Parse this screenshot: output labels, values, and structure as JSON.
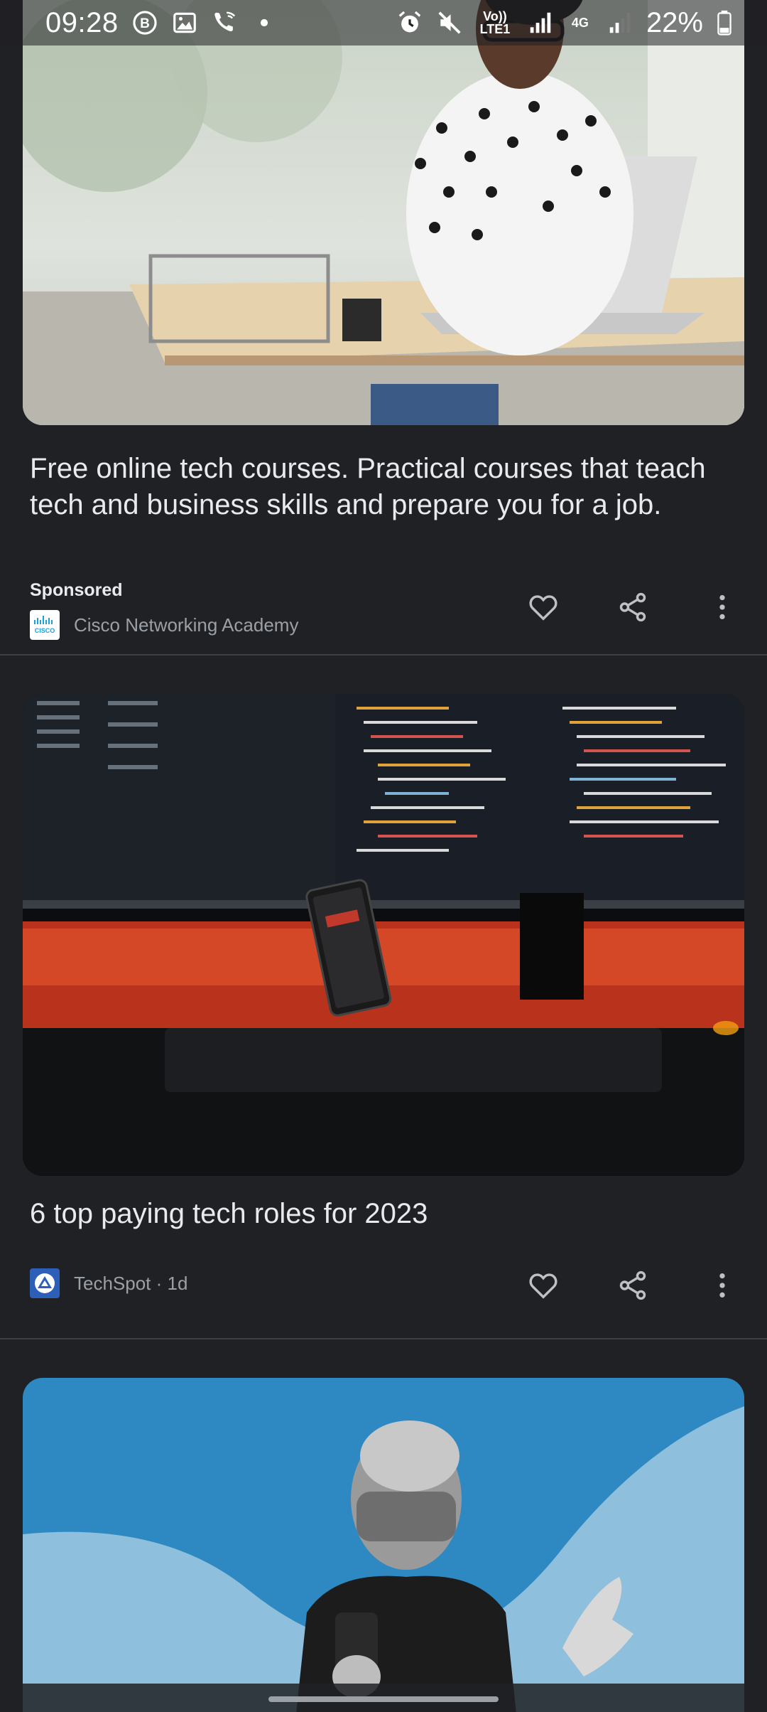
{
  "status_bar": {
    "time": "09:28",
    "left_icons": [
      "b-circle-icon",
      "gallery-icon",
      "wifi-call-icon",
      "dot-icon"
    ],
    "right_icons": [
      "alarm-icon",
      "mute-icon",
      "volte-icon",
      "signal-icon",
      "4g-icon",
      "signal-icon",
      "battery-icon"
    ],
    "volte_top": "Vo))",
    "volte_bottom": "LTE1",
    "network": "4G",
    "battery": "22%"
  },
  "feed": {
    "cards": [
      {
        "title": "Free online tech courses. Practical courses that teach tech and business skills and prepare you for a job.",
        "sponsored_label": "Sponsored",
        "source": "Cisco Networking Academy",
        "source_logo_text": "CISCO",
        "image_subject": "woman-at-laptop"
      },
      {
        "title": "6 top paying tech roles for 2023",
        "source": "TechSpot · 1d",
        "image_subject": "code-monitors"
      },
      {
        "image_subject": "speaker-on-stage"
      }
    ]
  },
  "colors": {
    "background": "#202124",
    "text": "#e8eaed",
    "secondary_text": "#9aa0a6",
    "divider": "#3c4043"
  }
}
